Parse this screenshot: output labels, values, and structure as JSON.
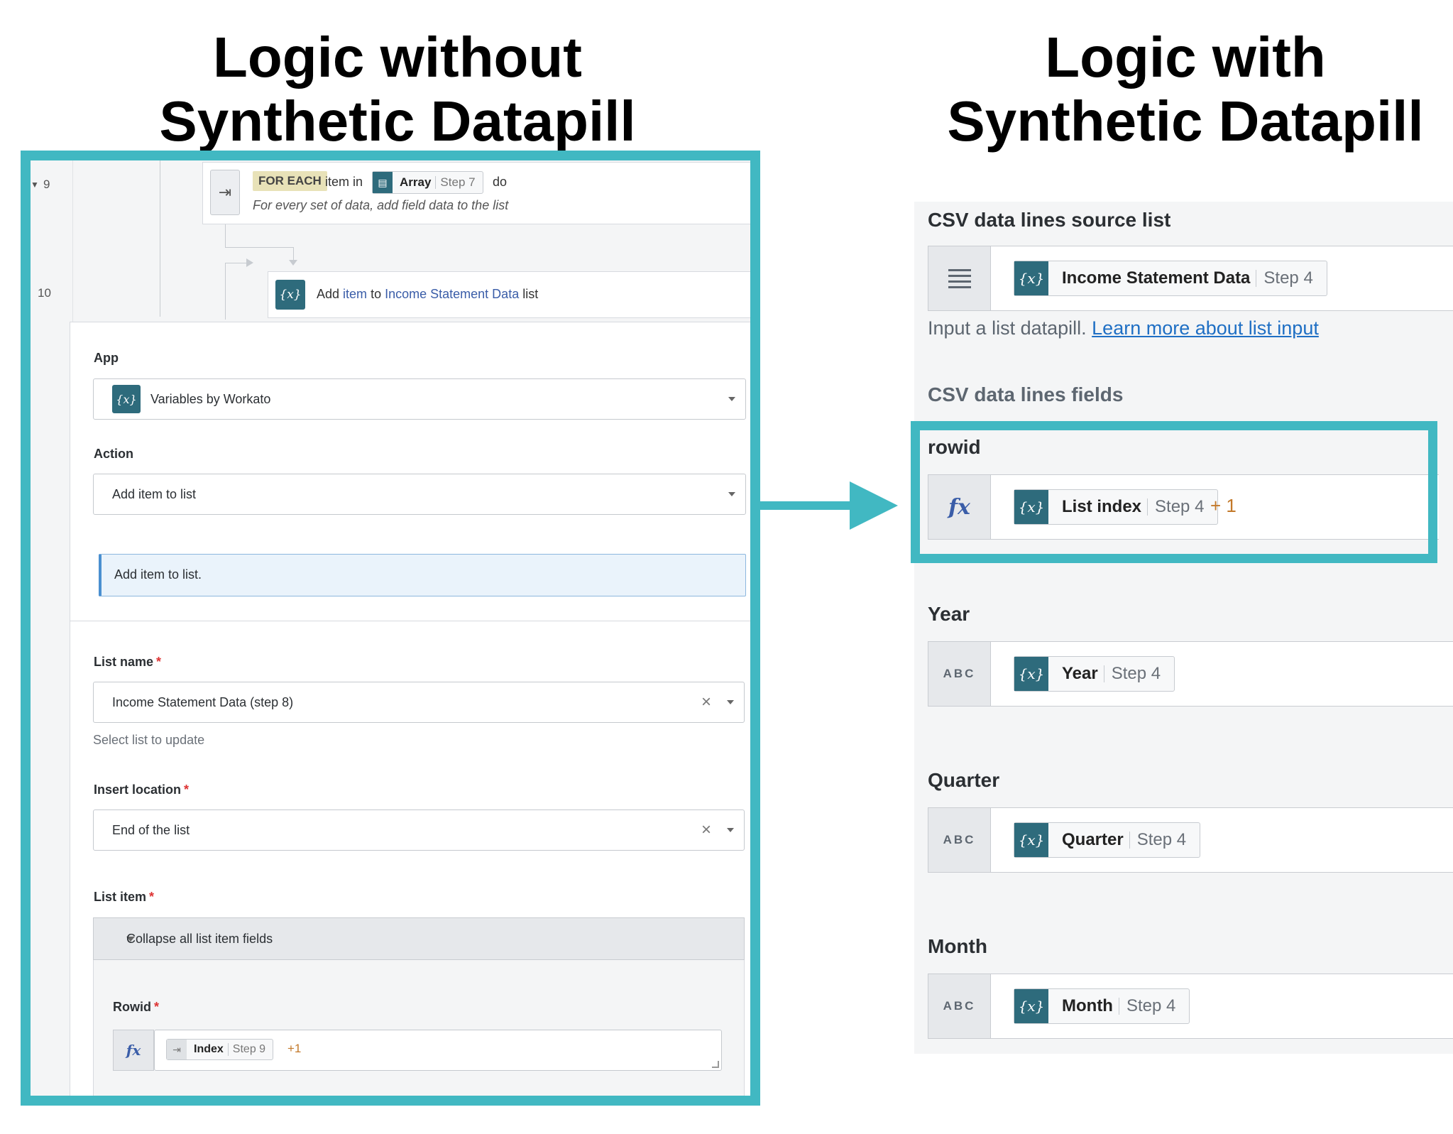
{
  "headlines": {
    "left_line1": "Logic without",
    "left_line2": "Synthetic Datapill",
    "right_line1": "Logic with",
    "right_line2": "Synthetic Datapill"
  },
  "colors": {
    "accent_frame": "#41b8c2",
    "variable_icon": "#2e6b7c",
    "link": "#1f6fc4",
    "increment": "#c3792a"
  },
  "recipe": {
    "step9": {
      "line": "9",
      "tag": "FOR EACH",
      "item_in": "item in",
      "pill_name": "Array",
      "pill_step": "Step 7",
      "do": "do",
      "description": "For every set of data, add field data to the list"
    },
    "step10": {
      "line": "10",
      "verb": "Add",
      "item": "item",
      "to": "to",
      "list_name": "Income Statement Data",
      "suffix": "list"
    }
  },
  "form": {
    "app_label": "App",
    "app_value": "Variables by Workato",
    "action_label": "Action",
    "action_value": "Add item to list",
    "info": "Add item to list.",
    "list_name_label": "List name",
    "list_name_value": "Income Statement Data (step 8)",
    "list_name_hint": "Select list to update",
    "insert_location_label": "Insert location",
    "insert_location_value": "End of the list",
    "list_item_label": "List item",
    "collapse_label": "Collapse all list item fields",
    "rowid_label": "Rowid",
    "rowid_pill_name": "Index",
    "rowid_pill_step": "Step 9",
    "rowid_plus": "+1",
    "required_mark": "*",
    "clear_glyph": "×"
  },
  "right": {
    "source_label": "CSV data lines source list",
    "source_pill_name": "Income Statement Data",
    "source_pill_step": "Step 4",
    "source_hint": "Input a list datapill.",
    "source_link": "Learn more about list input",
    "fields_label": "CSV data lines fields",
    "fields": [
      {
        "label": "rowid",
        "icon": "fx",
        "pill_name": "List index",
        "pill_step": "Step 4",
        "plus": "+ 1"
      },
      {
        "label": "Year",
        "icon": "ABC",
        "pill_name": "Year",
        "pill_step": "Step 4"
      },
      {
        "label": "Quarter",
        "icon": "ABC",
        "pill_name": "Quarter",
        "pill_step": "Step 4"
      },
      {
        "label": "Month",
        "icon": "ABC",
        "pill_name": "Month",
        "pill_step": "Step 4"
      }
    ]
  },
  "icons": {
    "variable": "{x}",
    "formula": "fx",
    "text_type": "ABC"
  }
}
